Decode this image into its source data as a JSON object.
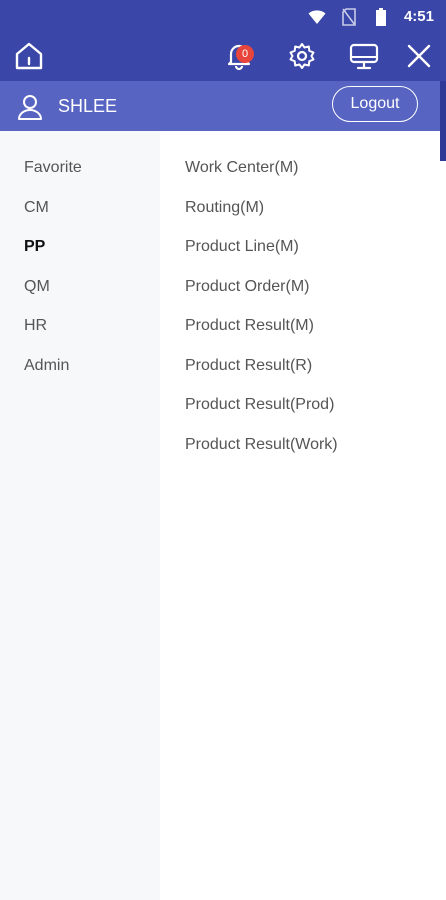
{
  "status_bar": {
    "time": "4:51",
    "icons": [
      "wifi-icon",
      "no-sim-icon",
      "battery-icon"
    ]
  },
  "toolbar": {
    "notification_count": "0",
    "icons": [
      "home-icon",
      "bell-icon",
      "gear-icon",
      "monitor-icon",
      "close-icon"
    ]
  },
  "user": {
    "name": "SHLEE",
    "logout_label": "Logout"
  },
  "sidebar": {
    "items": [
      {
        "label": "Favorite"
      },
      {
        "label": "CM"
      },
      {
        "label": "PP"
      },
      {
        "label": "QM"
      },
      {
        "label": "HR"
      },
      {
        "label": "Admin"
      }
    ],
    "active": "PP"
  },
  "submenu": {
    "items": [
      {
        "label": "Work Center(M)"
      },
      {
        "label": "Routing(M)"
      },
      {
        "label": "Product Line(M)"
      },
      {
        "label": "Product Order(M)"
      },
      {
        "label": "Product Result(M)"
      },
      {
        "label": "Product Result(R)"
      },
      {
        "label": "Product Result(Prod)"
      },
      {
        "label": "Product Result(Work)"
      }
    ]
  },
  "colors": {
    "header": "#3a46a8",
    "user_bar": "#5864c2",
    "badge": "#e8453c",
    "sidebar_bg": "#f7f8fa"
  }
}
